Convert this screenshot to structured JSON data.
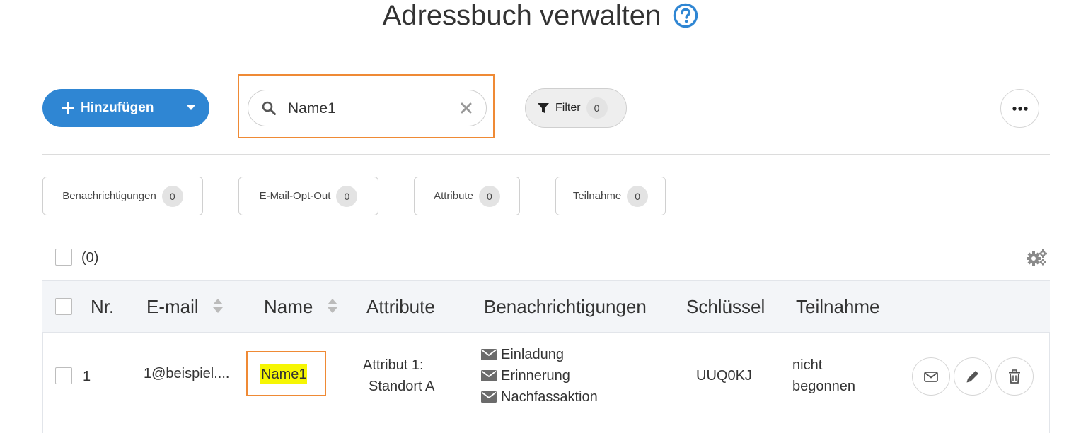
{
  "page": {
    "title": "Adressbuch verwalten",
    "help_icon": "question-circle-icon"
  },
  "toolbar": {
    "add_label": "Hinzufügen",
    "search_value": "Name1",
    "filter_label": "Filter",
    "filter_count": "0",
    "more_icon": "ellipsis-icon"
  },
  "chips": [
    {
      "label": "Benachrichtigungen",
      "count": "0"
    },
    {
      "label": "E-Mail-Opt-Out",
      "count": "0"
    },
    {
      "label": "Attribute",
      "count": "0"
    },
    {
      "label": "Teilnahme",
      "count": "0"
    }
  ],
  "selection": {
    "count_label": "(0)"
  },
  "table": {
    "columns": [
      "Nr.",
      "E-mail",
      "Name",
      "Attribute",
      "Benachrichtigungen",
      "Schlüssel",
      "Teilnahme"
    ],
    "rows": [
      {
        "nr": "1",
        "email": "1@beispiel....",
        "name": "Name1",
        "attribute_line1": "Attribut 1:",
        "attribute_line2": "Standort A",
        "notifications": [
          "Einladung",
          "Erinnerung",
          "Nachfassaktion"
        ],
        "key": "UUQ0KJ",
        "participation_line1": "nicht",
        "participation_line2": "begonnen"
      }
    ]
  },
  "colors": {
    "primary": "#2f86d3",
    "highlight_border": "#ef8a35",
    "search_match": "#f6f603"
  }
}
